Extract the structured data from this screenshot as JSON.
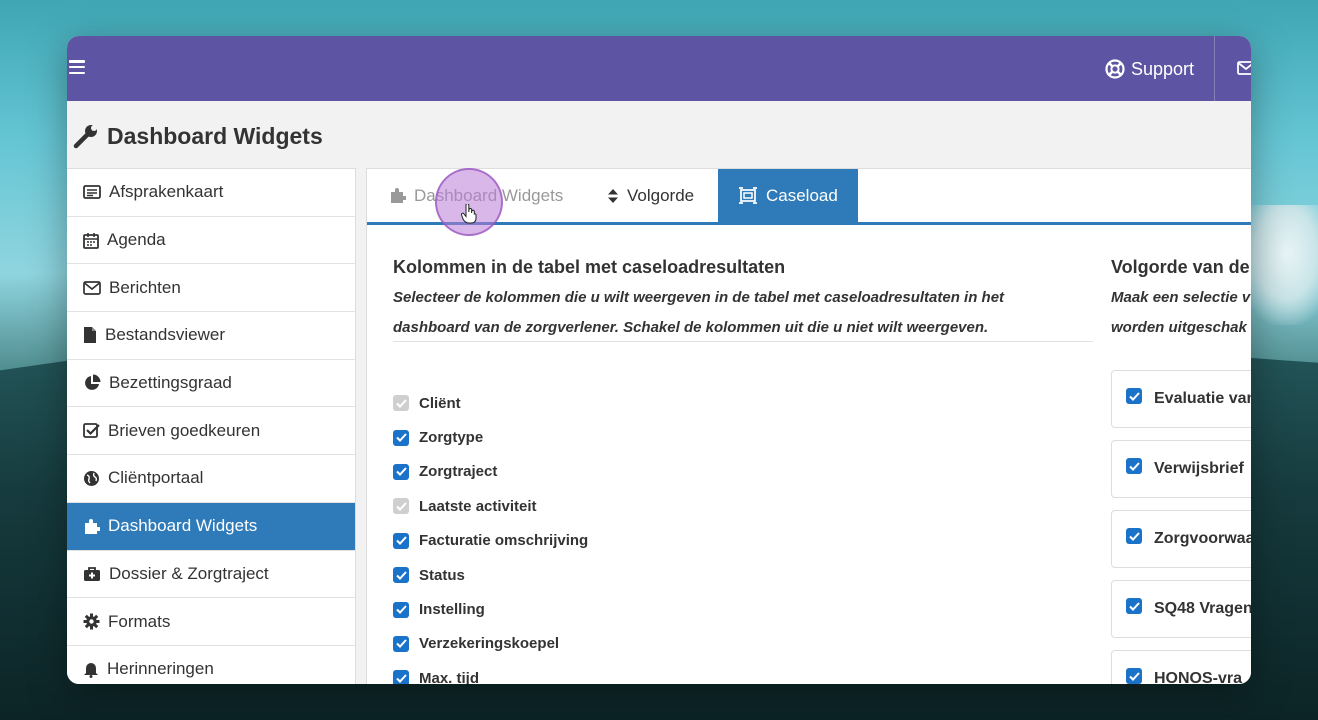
{
  "topbar": {
    "support_label": "Support",
    "accent_color": "#5e54a4"
  },
  "page": {
    "title": "Dashboard Widgets"
  },
  "sidebar": {
    "items": [
      {
        "label": "Afsprakenkaart",
        "icon": "card-icon"
      },
      {
        "label": "Agenda",
        "icon": "calendar-icon"
      },
      {
        "label": "Berichten",
        "icon": "envelope-icon"
      },
      {
        "label": "Bestandsviewer",
        "icon": "file-icon"
      },
      {
        "label": "Bezettingsgraad",
        "icon": "pie-chart-icon"
      },
      {
        "label": "Brieven goedkeuren",
        "icon": "check-square-icon"
      },
      {
        "label": "Cliëntportaal",
        "icon": "globe-icon"
      },
      {
        "label": "Dashboard Widgets",
        "icon": "puzzle-icon",
        "active": true
      },
      {
        "label": "Dossier & Zorgtraject",
        "icon": "medkit-icon"
      },
      {
        "label": "Formats",
        "icon": "gear-icon"
      },
      {
        "label": "Herinneringen",
        "icon": "bell-icon"
      }
    ],
    "active_color": "#2f7ab8"
  },
  "tabs": [
    {
      "label": "Dashboard Widgets",
      "icon": "puzzle-icon",
      "state": "muted"
    },
    {
      "label": "Volgorde",
      "icon": "sort-icon",
      "state": "normal"
    },
    {
      "label": "Caseload",
      "icon": "caseload-icon",
      "state": "active"
    }
  ],
  "columns_section": {
    "title": "Kolommen in de tabel met caseloadresultaten",
    "desc_line1": "Selecteer de kolommen die u wilt weergeven in de tabel met caseloadresultaten in het",
    "desc_line2": "dashboard van de zorgverlener. Schakel de kolommen uit die u niet wilt weergeven.",
    "items": [
      {
        "label": "Cliënt",
        "checked": true,
        "disabled": true
      },
      {
        "label": "Zorgtype",
        "checked": true,
        "disabled": false
      },
      {
        "label": "Zorgtraject",
        "checked": true,
        "disabled": false
      },
      {
        "label": "Laatste activiteit",
        "checked": true,
        "disabled": true
      },
      {
        "label": "Facturatie omschrijving",
        "checked": true,
        "disabled": false
      },
      {
        "label": "Status",
        "checked": true,
        "disabled": false
      },
      {
        "label": "Instelling",
        "checked": true,
        "disabled": false
      },
      {
        "label": "Verzekeringskoepel",
        "checked": true,
        "disabled": false
      },
      {
        "label": "Max. tijd",
        "checked": true,
        "disabled": false
      }
    ]
  },
  "order_section": {
    "title": "Volgorde van de",
    "desc_line1": "Maak een selectie v",
    "desc_line2": "worden uitgeschak",
    "items": [
      {
        "label": "Evaluatie van",
        "checked": true
      },
      {
        "label": "Verwijsbrief",
        "checked": true
      },
      {
        "label": "Zorgvoorwaa",
        "checked": true
      },
      {
        "label": "SQ48 Vragen",
        "checked": true
      },
      {
        "label": "HONOS-vra",
        "checked": true
      }
    ]
  }
}
